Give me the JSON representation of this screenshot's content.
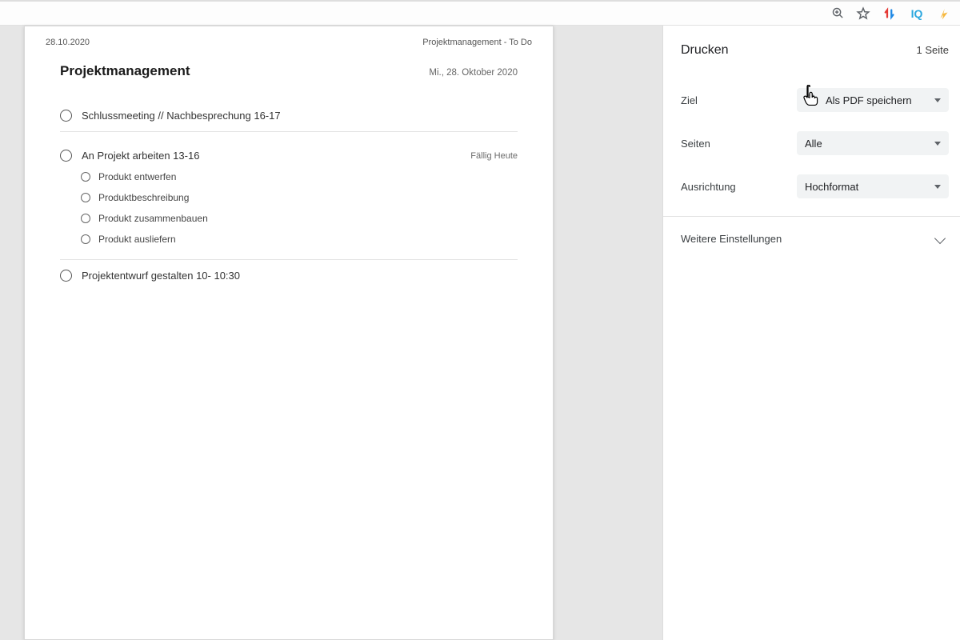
{
  "browser_bar": {
    "ext_iq_label": "IQ"
  },
  "page": {
    "meta_date": "28.10.2020",
    "meta_title": "Projektmanagement - To Do",
    "title": "Projektmanagement",
    "date_long": "Mi., 28. Oktober 2020",
    "tasks": [
      {
        "label": "Schlussmeeting // Nachbesprechung 16-17"
      },
      {
        "label": "An Projekt arbeiten 13-16",
        "meta": "Fällig Heute",
        "subtasks": [
          "Produkt entwerfen",
          "Produktbeschreibung",
          "Produkt zusammenbauen",
          "Produkt ausliefern"
        ]
      },
      {
        "label": "Projektentwurf gestalten 10- 10:30"
      }
    ]
  },
  "sidebar": {
    "title": "Drucken",
    "page_count": "1 Seite",
    "settings": {
      "destination": {
        "label": "Ziel",
        "value": "Als PDF speichern"
      },
      "pages": {
        "label": "Seiten",
        "value": "Alle"
      },
      "layout": {
        "label": "Ausrichtung",
        "value": "Hochformat"
      }
    },
    "more": "Weitere Einstellungen"
  }
}
